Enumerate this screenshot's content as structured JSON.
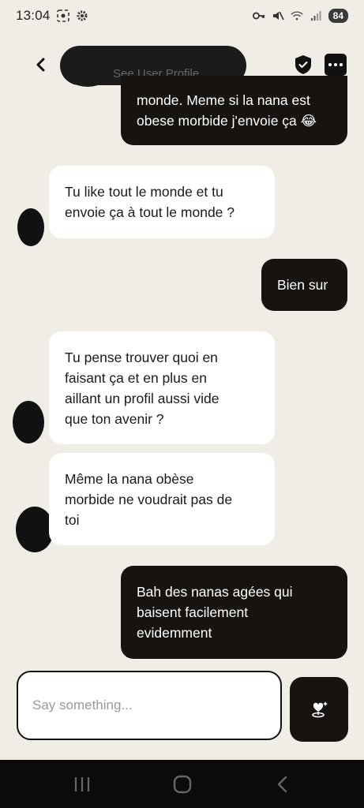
{
  "status_bar": {
    "time": "13:04",
    "battery": "84"
  },
  "header": {
    "see_profile": "See User Profile"
  },
  "messages": [
    {
      "direction": "out",
      "text": "monde. Meme si la nana est\nobese morbide j'envoie ça 😂"
    },
    {
      "direction": "in",
      "text": "Tu like tout le monde et tu\nenvoie ça à tout le monde ?"
    },
    {
      "direction": "out",
      "text": "Bien sur"
    },
    {
      "direction": "in",
      "text": "Tu pense trouver quoi en\nfaisant ça et en plus en\naillant un profil aussi vide\nque ton avenir ?"
    },
    {
      "direction": "in",
      "text": "Même la nana obèse\nmorbide ne voudrait pas de\ntoi"
    },
    {
      "direction": "out",
      "text": "Bah des nanas agées qui\nbaisent facilement\nevidemment"
    }
  ],
  "composer": {
    "placeholder": "Say something..."
  },
  "colors": {
    "background": "#F0ECE6",
    "outgoing_bubble": "#161310",
    "incoming_bubble": "#FFFFFF"
  },
  "icons": {
    "back": "chevron-left-icon",
    "shield": "shield-check-icon",
    "more": "more-dots-icon",
    "send": "heart-sparkle-icon"
  }
}
